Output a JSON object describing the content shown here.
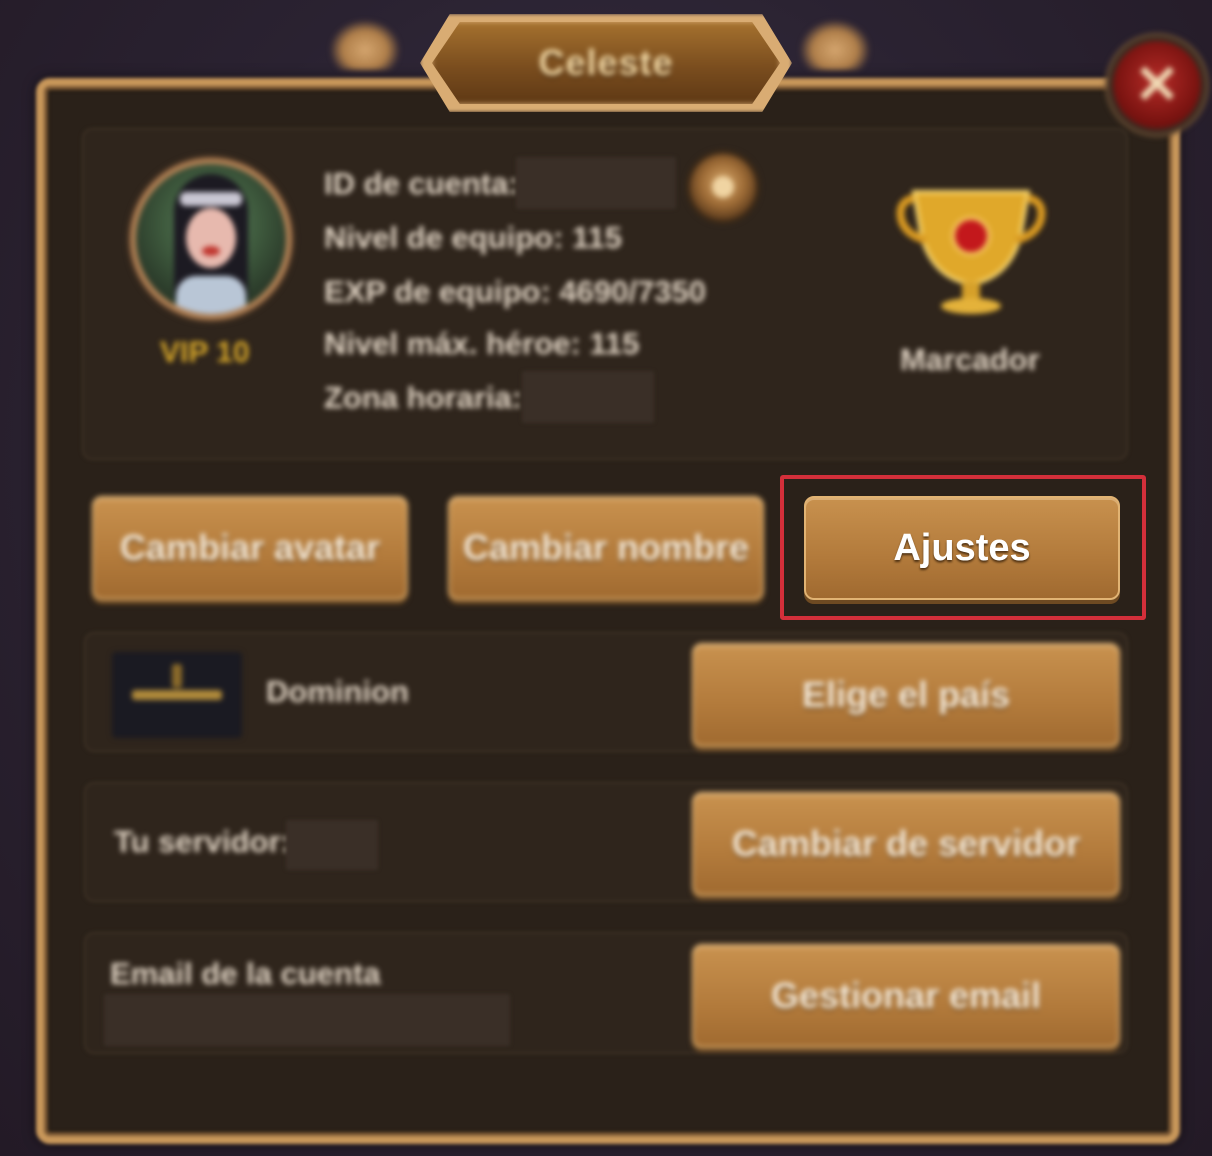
{
  "dialog": {
    "title": "Celeste",
    "close_icon": "close-icon"
  },
  "profile": {
    "vip_label": "VIP 10",
    "account_id_label": "ID de cuenta:",
    "team_level_label": "Nivel de equipo: 115",
    "team_exp_label": "EXP de equipo: 4690/7350",
    "max_hero_level_label": "Nivel máx. héroe: 115",
    "timezone_label": "Zona horaria:",
    "leaderboard_label": "Marcador"
  },
  "actions": {
    "change_avatar": "Cambiar avatar",
    "change_name": "Cambiar nombre",
    "settings": "Ajustes"
  },
  "guild": {
    "name": "Dominion",
    "choose_country": "Elige el país"
  },
  "server": {
    "label": "Tu servidor:",
    "change_server": "Cambiar de servidor"
  },
  "email": {
    "label": "Email de la cuenta",
    "manage_email": "Gestionar email"
  },
  "colors": {
    "frame": "#c8975a",
    "button": "#b27a3b",
    "highlight": "#d32f3a",
    "vip": "#d8a82a"
  }
}
